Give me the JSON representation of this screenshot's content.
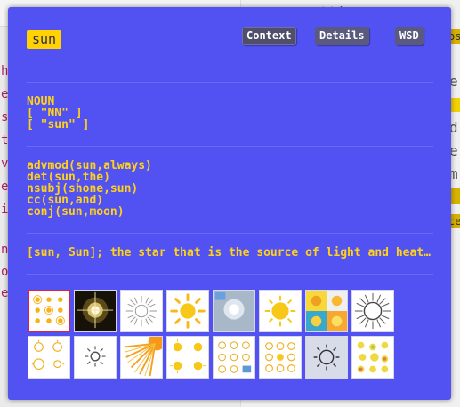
{
  "popup": {
    "word": "sun",
    "tabs": [
      "Context",
      "Details",
      "WSD"
    ],
    "active_tab": "Context",
    "pos_lines": [
      "NOUN",
      "[ \"NN\" ]",
      "[ \"sun\" ]"
    ],
    "dep_lines": [
      "advmod(sun,always)",
      "det(sun,the)",
      "nsubj(shone,sun)",
      "cc(sun,and)",
      "conj(sun,moon)"
    ],
    "gloss": "[sun, Sun]; the star that is the source of light and heat for the planets in the solar system",
    "images": [
      {
        "icon": "sun-icons-grid-icon",
        "selected": true
      },
      {
        "icon": "sun-glow-dark-icon"
      },
      {
        "icon": "sun-line-art-icon"
      },
      {
        "icon": "sun-yellow-rays-icon"
      },
      {
        "icon": "sun-sky-flare-icon"
      },
      {
        "icon": "sun-yellow-icon"
      },
      {
        "icon": "sun-colored-tiles-icon"
      },
      {
        "icon": "sun-sketch-icon"
      },
      {
        "icon": "sun-outline-icons-icon"
      },
      {
        "icon": "sun-small-grey-icon"
      },
      {
        "icon": "sun-corner-rays-icon"
      },
      {
        "icon": "sun-icons-set-icon"
      },
      {
        "icon": "sun-line-icons-icon"
      },
      {
        "icon": "sun-outline-set-icon"
      },
      {
        "icon": "sun-grey-outline-icon"
      },
      {
        "icon": "sun-cartoon-set-icon"
      }
    ]
  },
  "background": {
    "left_letters": [
      "h",
      "e",
      "s",
      "t",
      "v",
      "e",
      "i",
      "n",
      "o",
      "e"
    ],
    "right_letters": [
      "e",
      "d",
      "e",
      "m",
      "e"
    ],
    "chip_letters": [
      "os",
      "ce"
    ],
    "top_text": "cettive ans ec"
  },
  "colors": {
    "popup_bg": "#5252f2",
    "text_yellow": "#ffd21a",
    "badge": "#ffd200",
    "tab_bg": "#5a5a7e"
  }
}
